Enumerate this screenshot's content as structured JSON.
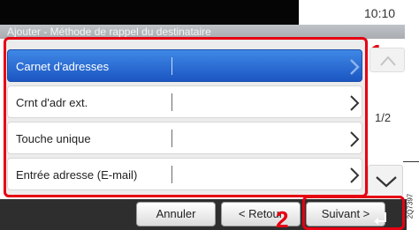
{
  "header": {
    "time": "10:10"
  },
  "title": {
    "text": "Ajouter - Méthode de rappel du destinataire"
  },
  "list": {
    "items": [
      {
        "label": "Carnet d'adresses",
        "selected": true
      },
      {
        "label": "Crnt d'adr ext.",
        "selected": false
      },
      {
        "label": "Touche unique",
        "selected": false
      },
      {
        "label": "Entrée adresse (E-mail)",
        "selected": false
      }
    ]
  },
  "pagination": {
    "indicator": "1/2"
  },
  "footer": {
    "cancel_label": "Annuler",
    "back_label": "< Retour",
    "next_label": "Suivant >"
  },
  "callouts": {
    "first": "1",
    "second": "2"
  },
  "doc_code": "2Q7397",
  "colors": {
    "highlight": "#e60012",
    "selected_row": "#2a6bd6",
    "bottom_bar": "#2e2e2e"
  },
  "icons": [
    "chevron-right-icon",
    "chevron-up-icon",
    "chevron-down-icon",
    "enter-icon"
  ]
}
